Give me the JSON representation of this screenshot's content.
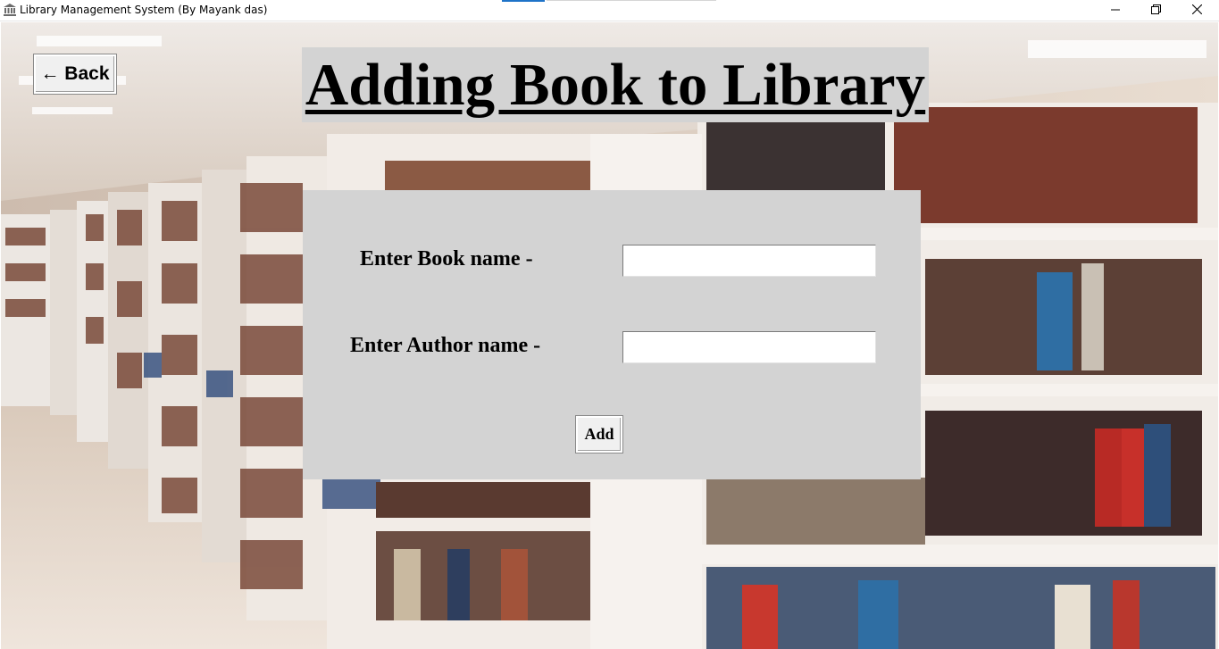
{
  "window": {
    "title": "Library Management System (By Mayank das)",
    "icon": "bank-icon",
    "controls": [
      "minimize-icon",
      "maximize-icon",
      "close-icon"
    ]
  },
  "back_button": {
    "label": "← Back"
  },
  "heading": "Adding Book to Library",
  "form": {
    "book_label": "Enter Book name -",
    "book_value": "",
    "author_label": "Enter Author name -",
    "author_value": "",
    "add_label": "Add"
  },
  "colors": {
    "panel": "#d3d3d3",
    "button": "#f0f0f0",
    "text": "#000000"
  },
  "background_image": "library-shelves-photo"
}
